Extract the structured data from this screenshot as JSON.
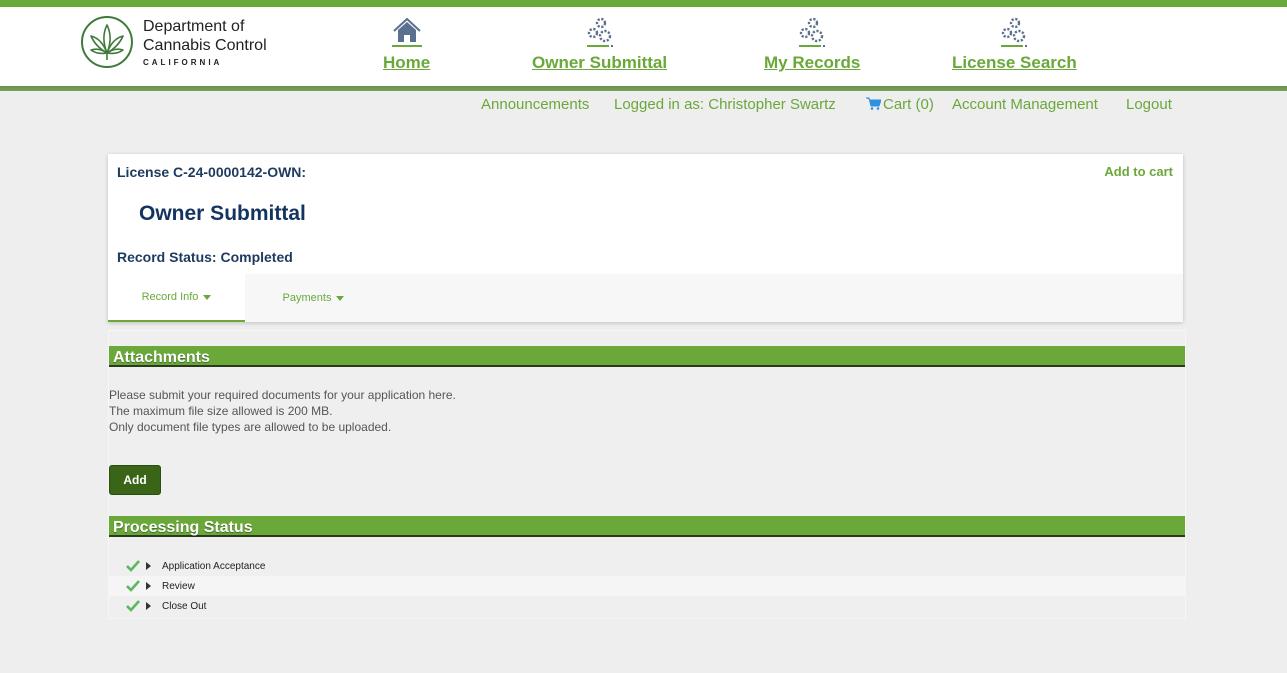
{
  "brand": {
    "line1": "Department of",
    "line2": "Cannabis Control",
    "sub": "CALIFORNIA",
    "accent_color": "#6aa83a",
    "navy_color": "#1d3a5f"
  },
  "nav": [
    {
      "label": "Home",
      "icon": "home-icon"
    },
    {
      "label": "Owner Submittal",
      "icon": "gears-icon"
    },
    {
      "label": "My Records",
      "icon": "gears-icon"
    },
    {
      "label": "License Search",
      "icon": "gears-icon"
    }
  ],
  "utility": {
    "announcements": "Announcements",
    "logged_in": "Logged in as: Christopher Swartz",
    "cart": "Cart (0)",
    "account": "Account Management",
    "logout": "Logout"
  },
  "record": {
    "license": "License C-24-0000142-OWN:",
    "add_to_cart": "Add to cart",
    "title": "Owner Submittal",
    "status": "Record Status: Completed",
    "tabs": [
      {
        "label": "Record Info",
        "active": true
      },
      {
        "label": "Payments",
        "active": false
      }
    ]
  },
  "attachments": {
    "heading": "Attachments",
    "lines": [
      "Please submit your required documents for your application here.",
      "The maximum file size allowed is 200 MB.",
      "Only document file types are allowed to be uploaded."
    ],
    "add_label": "Add"
  },
  "processing": {
    "heading": "Processing Status",
    "steps": [
      {
        "label": "Application Acceptance",
        "status": "complete"
      },
      {
        "label": "Review",
        "status": "complete"
      },
      {
        "label": "Close Out",
        "status": "complete"
      }
    ]
  }
}
